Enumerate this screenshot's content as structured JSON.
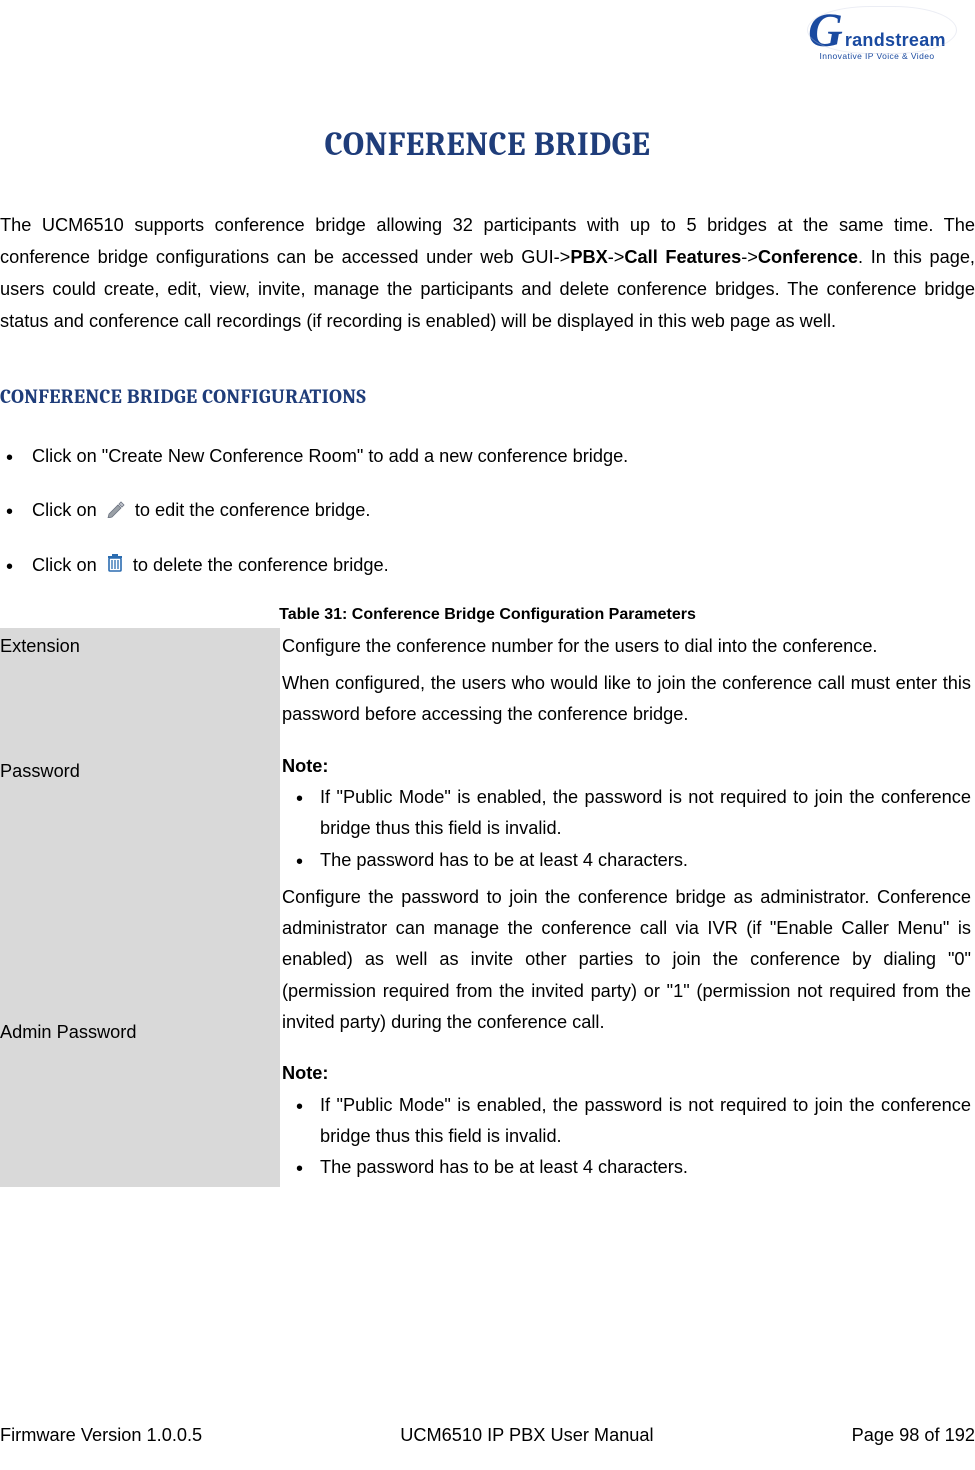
{
  "logo": {
    "main": "randstream",
    "tagline": "Innovative IP Voice & Video"
  },
  "title": "CONFERENCE BRIDGE",
  "intro": {
    "seg1": "The UCM6510 supports conference bridge allowing 32 participants with up to 5 bridges at the same time. The conference bridge configurations can be accessed under web GUI->",
    "b1": "PBX",
    "seg2": "->",
    "b2": "Call Features",
    "seg3": "->",
    "b3": "Conference",
    "seg4": ". In this page, users could create, edit, view, invite, manage the participants and delete conference bridges. The conference bridge status and conference call recordings (if recording is enabled) will be displayed in this web page as well."
  },
  "section_heading": "CONFERENCE BRIDGE CONFIGURATIONS",
  "bullets": {
    "b1": "Click on \"Create New Conference Room\" to add a new conference bridge.",
    "b2a": "Click on",
    "b2b": "to edit the conference bridge.",
    "b3a": "Click on",
    "b3b": "to delete the conference bridge."
  },
  "table": {
    "caption": "Table 31: Conference Bridge Configuration Parameters",
    "rows": {
      "extension": {
        "key": "Extension",
        "val": "Configure the conference number for the users to dial into the conference."
      },
      "password": {
        "key": "Password",
        "intro": "When configured, the users who would like to join the conference call must enter this password before accessing the conference bridge.",
        "note_label": "Note:",
        "n1": "If \"Public Mode\" is enabled, the password is not required to join the conference bridge thus this field is invalid.",
        "n2": "The password has to be at least 4 characters."
      },
      "admin": {
        "key": "Admin Password",
        "intro": "Configure the password to join the conference bridge as administrator. Conference administrator can manage the conference call via IVR (if \"Enable Caller Menu\" is enabled) as well as invite other parties to join the conference by dialing \"0\" (permission required from the invited party) or \"1\" (permission not required from the invited party) during the conference call.",
        "note_label": "Note:",
        "n1": "If \"Public Mode\" is enabled, the password is not required to join the conference bridge thus this field is invalid.",
        "n2": "The password has to be at least 4 characters."
      }
    }
  },
  "footer": {
    "left": "Firmware Version 1.0.0.5",
    "center": "UCM6510 IP PBX User Manual",
    "right": "Page 98 of 192"
  }
}
